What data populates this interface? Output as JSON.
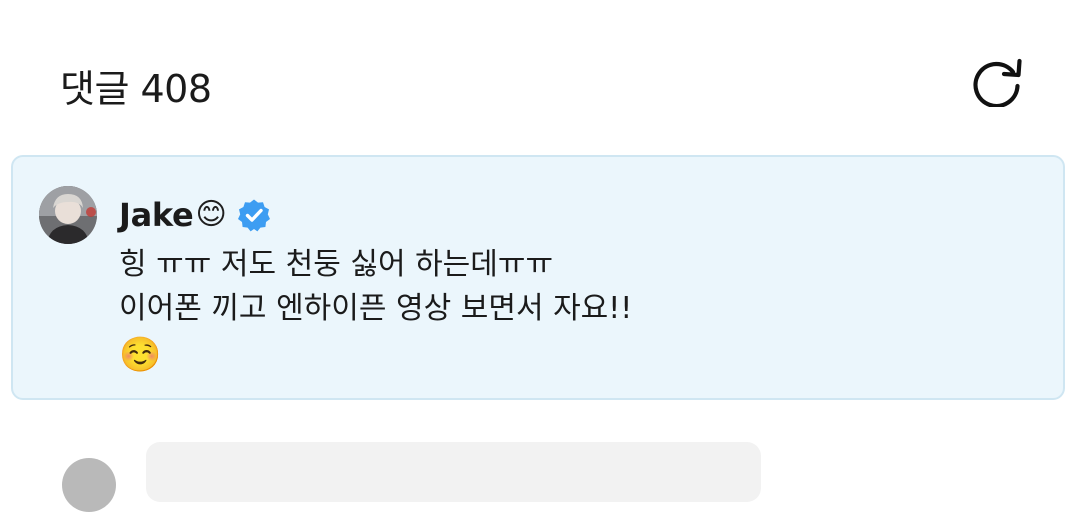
{
  "header": {
    "title": "댓글 408",
    "refresh_icon": "refresh-icon"
  },
  "pinned_comment": {
    "author": "Jake",
    "author_emoji": "😊",
    "verified_icon": "verified-badge-icon",
    "lines": [
      "힝 ㅠㅠ 저도 천둥 싫어 하는데ㅠㅠ",
      "이어폰 끼고 엔하이픈 영상 보면서 자요!!"
    ],
    "emoji_line": "☺️",
    "colors": {
      "card_background": "#ebf6fc",
      "card_border": "#cfe6f2",
      "verified": "#3d9df2"
    }
  }
}
